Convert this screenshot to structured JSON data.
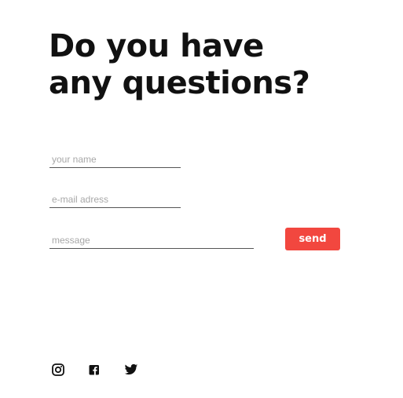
{
  "contact": {
    "heading_line1": "Do you have",
    "heading_line2": "any questions?",
    "name_placeholder": "your name",
    "email_placeholder": "e-mail adress",
    "message_placeholder": "message",
    "send_label": "send"
  },
  "colors": {
    "accent": "#f2473f",
    "text": "#111111",
    "placeholder": "#a8a8a8",
    "underline": "#555555"
  },
  "social": [
    {
      "icon": "instagram-icon"
    },
    {
      "icon": "facebook-icon"
    },
    {
      "icon": "twitter-icon"
    }
  ]
}
